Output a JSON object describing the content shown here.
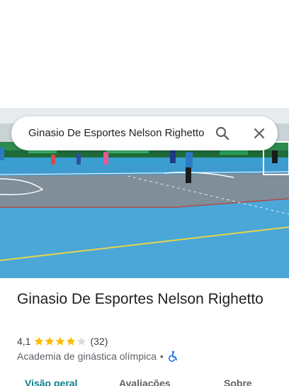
{
  "search": {
    "query": "Ginasio De Esportes Nelson Righetto"
  },
  "place": {
    "name": "Ginasio De Esportes Nelson Righetto",
    "rating": "4,1",
    "rating_value": 4.1,
    "rating_max": 5,
    "review_count": "(32)",
    "category": "Academia de ginástica olímpica",
    "separator": "•",
    "wheelchair_icon": "wheelchair-accessible-icon"
  },
  "tabs": [
    {
      "label": "Visão geral",
      "selected": true
    },
    {
      "label": "Avaliações",
      "selected": false
    },
    {
      "label": "Sobre",
      "selected": false
    }
  ],
  "colors": {
    "star": "#fbbc04",
    "star_empty": "#dadce0",
    "accent": "#0b7e8c",
    "access_icon": "#1a73e8"
  },
  "icons": {
    "search": "search-icon",
    "close": "close-icon"
  }
}
